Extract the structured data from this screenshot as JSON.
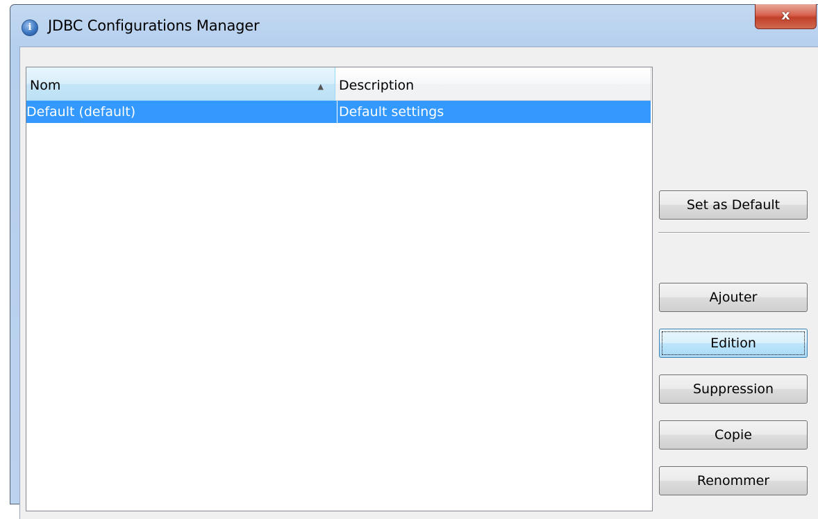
{
  "window": {
    "title": "JDBC Configurations Manager",
    "title_icon": "info-icon",
    "close_label": "x"
  },
  "table": {
    "columns": [
      "Nom",
      "Description"
    ],
    "sort_column": "Nom",
    "sort_direction": "ascending",
    "rows": [
      {
        "name": "Default (default)",
        "description": "Default settings",
        "selected": true
      }
    ]
  },
  "buttons": {
    "set_default": "Set as Default",
    "add": "Ajouter",
    "edit": "Edition",
    "delete": "Suppression",
    "copy": "Copie",
    "rename": "Renommer",
    "focused": "Edition"
  },
  "colors": {
    "selection": "#3399ff",
    "titlebar": "#c3d9f1",
    "close_button": "#c1402a"
  }
}
